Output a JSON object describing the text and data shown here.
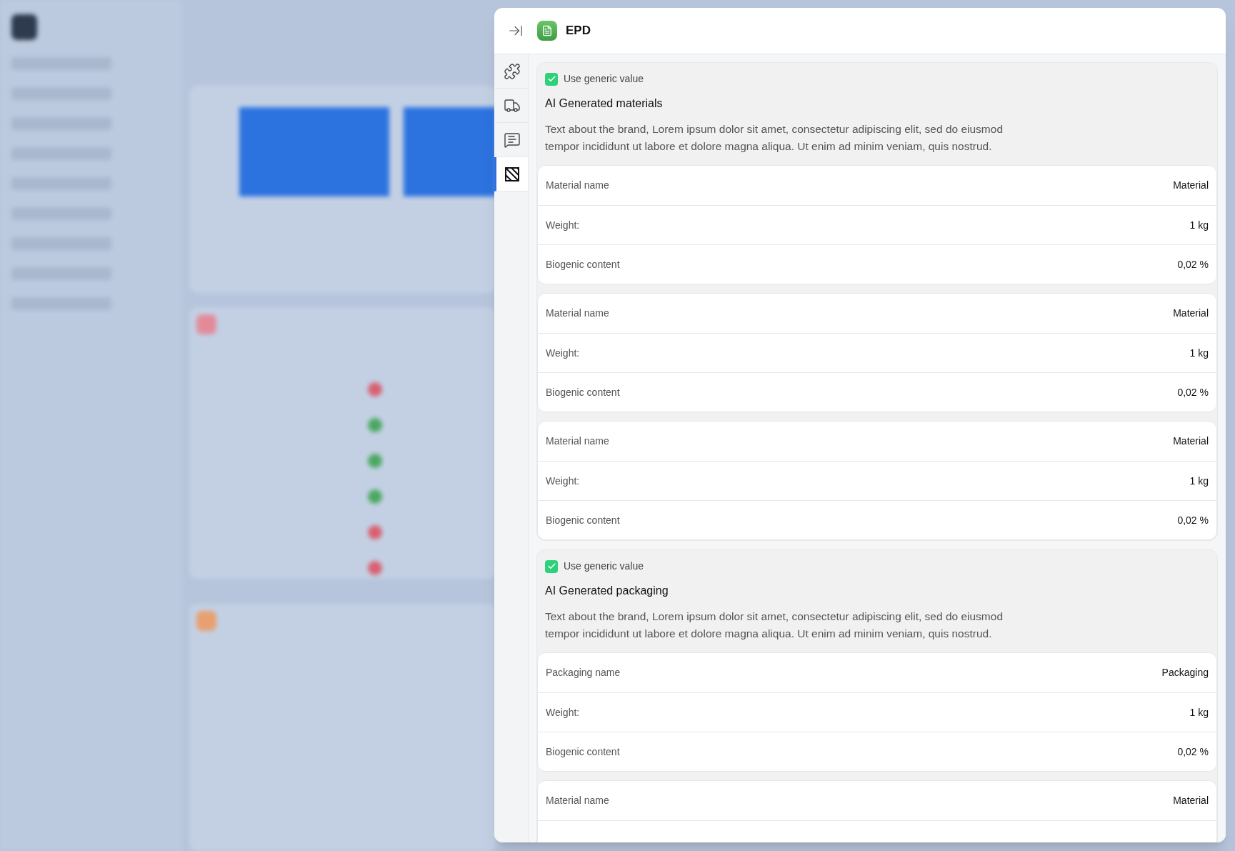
{
  "panel": {
    "title": "EPD"
  },
  "rail": [
    {
      "kind": "puzzle",
      "selected": false
    },
    {
      "kind": "truck",
      "selected": false
    },
    {
      "kind": "message",
      "selected": false
    },
    {
      "kind": "hatch",
      "selected": true
    }
  ],
  "sections": [
    {
      "generic": {
        "label": "Use generic value",
        "checked": true
      },
      "title": "AI Generated materials",
      "description": "Text about the brand, Lorem ipsum dolor sit amet, consectetur adipiscing elit, sed do eiusmod tempor incididunt ut labore et dolore magna aliqua. Ut enim ad minim veniam, quis nostrud.",
      "tables": [
        {
          "rows": [
            {
              "label": "Material name",
              "value": "Material"
            },
            {
              "label": "Weight:",
              "value": "1 kg"
            },
            {
              "label": "Biogenic content",
              "value": "0,02 %"
            }
          ]
        },
        {
          "rows": [
            {
              "label": "Material name",
              "value": "Material"
            },
            {
              "label": "Weight:",
              "value": "1 kg"
            },
            {
              "label": "Biogenic content",
              "value": "0,02 %"
            }
          ]
        },
        {
          "rows": [
            {
              "label": "Material name",
              "value": "Material"
            },
            {
              "label": "Weight:",
              "value": "1 kg"
            },
            {
              "label": "Biogenic content",
              "value": "0,02 %"
            }
          ]
        }
      ]
    },
    {
      "generic": {
        "label": "Use generic value",
        "checked": true
      },
      "title": "AI Generated packaging",
      "description": "Text about the brand, Lorem ipsum dolor sit amet, consectetur adipiscing elit, sed do eiusmod tempor incididunt ut labore et dolore magna aliqua. Ut enim ad minim veniam, quis nostrud.",
      "tables": [
        {
          "rows": [
            {
              "label": "Packaging name",
              "value": "Packaging"
            },
            {
              "label": "Weight:",
              "value": "1 kg"
            },
            {
              "label": "Biogenic content",
              "value": "0,02 %"
            }
          ]
        },
        {
          "rows": [
            {
              "label": "Material name",
              "value": "Material"
            }
          ]
        }
      ]
    }
  ]
}
